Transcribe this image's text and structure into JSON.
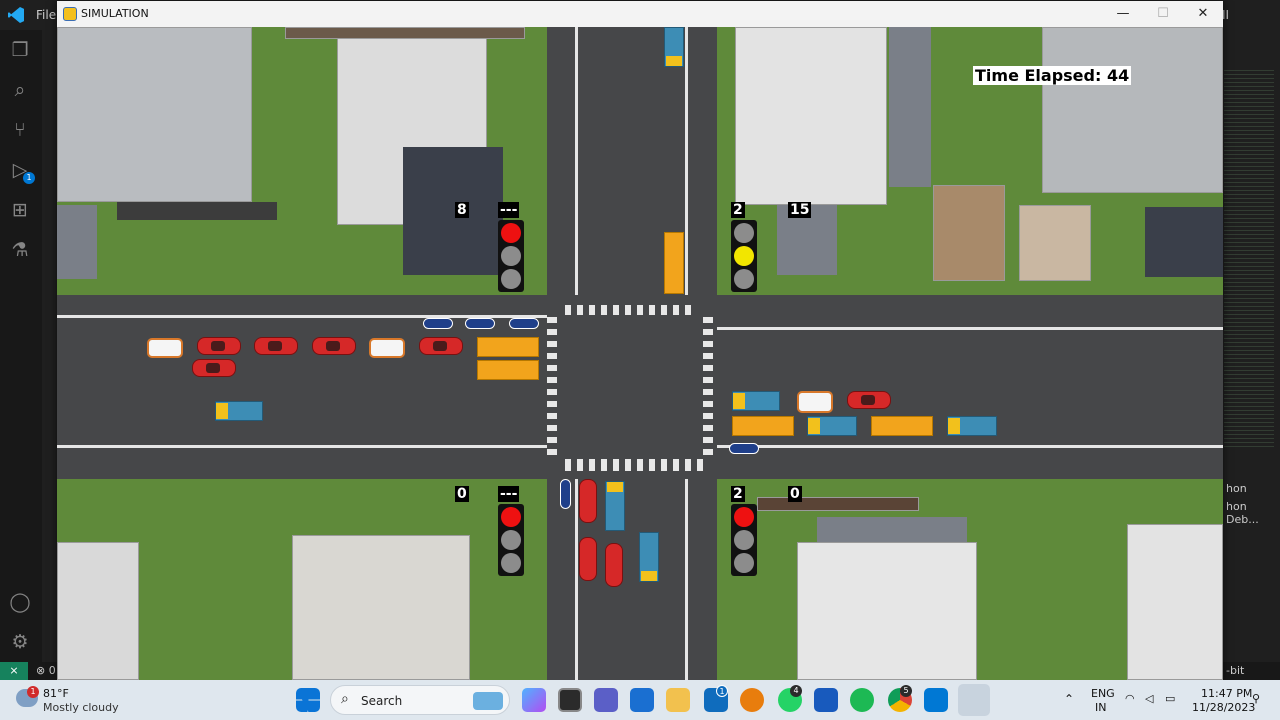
{
  "vscode": {
    "menu_file": "File",
    "right_cut": "ⅠⅠ",
    "debug_badge": "1",
    "panel_lines": [
      "hon",
      "hon Deb..."
    ],
    "status_left": "⊗ 0",
    "status_right": "-bit"
  },
  "window": {
    "title": "SIMULATION",
    "minimize": "—",
    "maximize": "☐",
    "close": "✕"
  },
  "simulation": {
    "time_elapsed": "Time Elapsed: 44",
    "signals": [
      {
        "id": "nw",
        "timer": "8",
        "countdown": "---",
        "state": "red"
      },
      {
        "id": "ne",
        "timer": "2",
        "countdown": "15",
        "state": "yellow"
      },
      {
        "id": "sw",
        "timer": "0",
        "countdown": "---",
        "state": "red"
      },
      {
        "id": "se",
        "timer": "2",
        "countdown": "0",
        "state": "red"
      }
    ],
    "colors": {
      "road": "#464749",
      "grass": "#5f8a3a",
      "lane": "#e6e6e6",
      "red_light": "#ee1111",
      "yellow_light": "#f2e600",
      "car": "#d62828",
      "bus": "#f2a41c",
      "truck": "#3d8db5"
    }
  },
  "taskbar": {
    "weather_temp": "81°F",
    "weather_desc": "Mostly cloudy",
    "weather_badge": "1",
    "search_placeholder": "Search",
    "lang": "ENG",
    "region": "IN",
    "time": "11:47 PM",
    "date": "11/28/2023",
    "badge_mail": "1",
    "badge_whatsapp": "4",
    "badge_chrome": "5"
  }
}
